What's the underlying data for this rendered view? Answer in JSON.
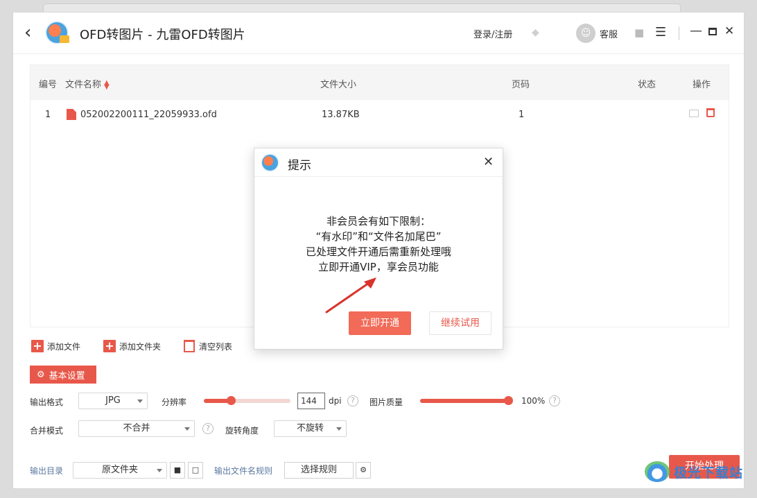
{
  "window": {
    "title": "OFD转图片 - 九雷OFD转图片",
    "login_label": "登录/注册",
    "service_label": "客服",
    "back_icon": "chevron-left-icon",
    "min_icon": "minimize-icon",
    "max_icon": "maximize-icon",
    "close_icon": "close-icon"
  },
  "table": {
    "headers": {
      "index": "编号",
      "name": "文件名称",
      "size": "文件大小",
      "pages": "页码",
      "status": "状态",
      "actions": "操作"
    },
    "rows": [
      {
        "index": "1",
        "name": "052002200111_22059933.ofd",
        "size": "13.87KB",
        "pages": "1",
        "status": ""
      }
    ]
  },
  "toolbar": {
    "add_file": "添加文件",
    "add_folder": "添加文件夹",
    "clear_list": "清空列表"
  },
  "settings": {
    "tag_label": "基本设置",
    "output_format_label": "输出格式",
    "output_format_value": "JPG",
    "resolution_label": "分辨率",
    "resolution_value": "144",
    "resolution_unit": "dpi",
    "resolution_fraction": 0.31,
    "quality_label": "图片质量",
    "quality_value": "100%",
    "quality_fraction": 1.0,
    "merge_label": "合并模式",
    "merge_value": "不合并",
    "rotate_label": "旋转角度",
    "rotate_value": "不旋转",
    "output_dir_label": "输出目录",
    "output_dir_value": "原文件夹",
    "filename_rule_label": "输出文件名规则",
    "filename_rule_button": "选择规则",
    "start_button": "开始处理",
    "help_glyph": "?"
  },
  "dialog": {
    "title": "提示",
    "lines": [
      "非会员会有如下限制：",
      "“有水印”和“文件名加尾巴”",
      "已处理文件开通后需重新处理哦",
      "立即开通VIP，享会员功能"
    ],
    "primary_button": "立即开通",
    "secondary_button": "继续试用"
  },
  "watermark": {
    "text": "极光下载站"
  },
  "colors": {
    "accent": "#e8584a",
    "dialog_primary": "#f26a58"
  }
}
